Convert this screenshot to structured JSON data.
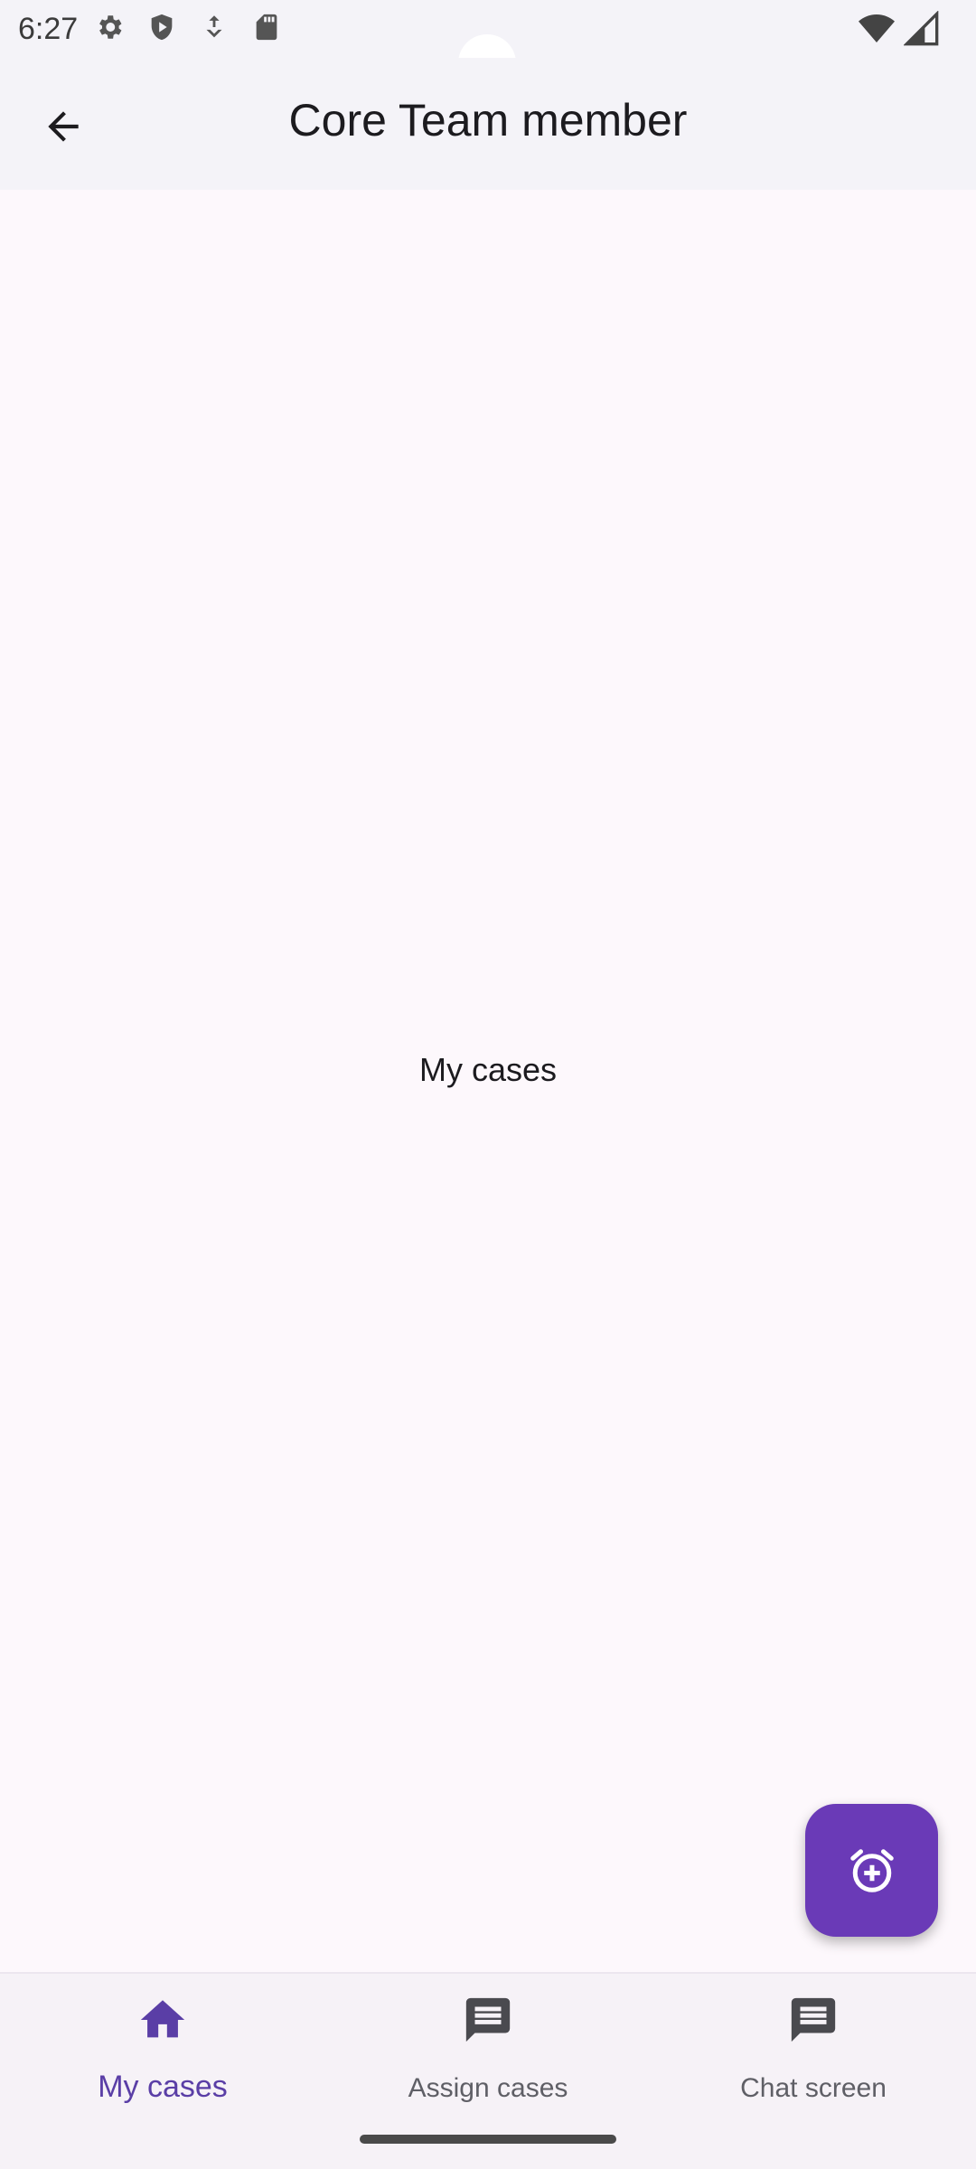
{
  "status_bar": {
    "time": "6:27",
    "left_icons": [
      "settings-icon",
      "shield-icon",
      "download-icon",
      "sd-card-icon"
    ],
    "right_icons": [
      "wifi-icon",
      "signal-icon"
    ]
  },
  "app_bar": {
    "back_icon": "arrow-back-icon",
    "title": "Core Team member"
  },
  "content": {
    "text": "My cases"
  },
  "fab": {
    "icon": "alarm-add-icon",
    "color": "#6a3ab7"
  },
  "bottom_nav": {
    "items": [
      {
        "label": "My cases",
        "icon": "home-icon",
        "active": true
      },
      {
        "label": "Assign cases",
        "icon": "message-icon",
        "active": false
      },
      {
        "label": "Chat screen",
        "icon": "message-icon",
        "active": false
      }
    ],
    "active_color": "#5a3ea6",
    "inactive_color": "#5f5f66"
  }
}
